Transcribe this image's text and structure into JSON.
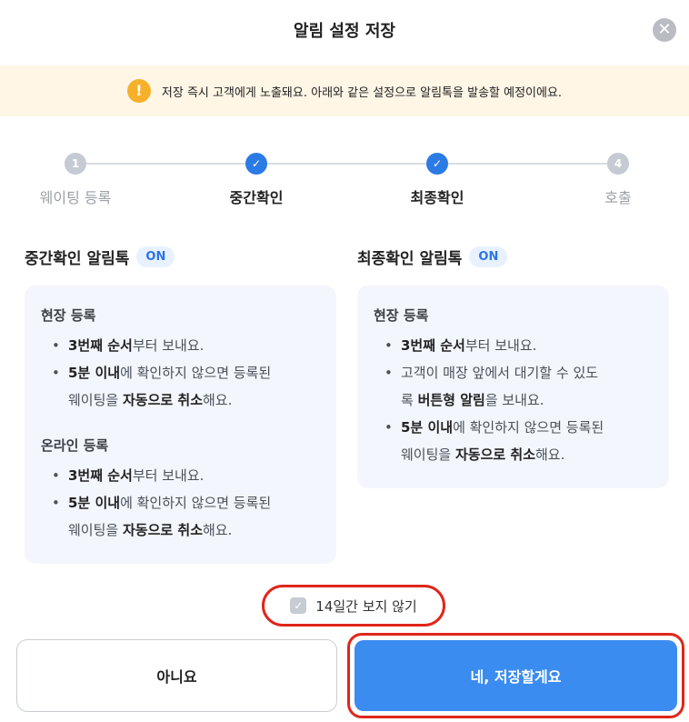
{
  "dialog": {
    "title": "알림 설정 저장",
    "close_icon": "close-icon"
  },
  "notice": {
    "icon": "exclamation-icon",
    "text": "저장 즉시 고객에게 노출돼요. 아래와 같은 설정으로  알림톡을 발송할 예정이에요."
  },
  "steps": [
    {
      "num": "1",
      "label": "웨이팅 등록",
      "state": "todo"
    },
    {
      "num": "✓",
      "label": "중간확인",
      "state": "done"
    },
    {
      "num": "✓",
      "label": "최종확인",
      "state": "done"
    },
    {
      "num": "4",
      "label": "호출",
      "state": "todo"
    }
  ],
  "middle": {
    "title": "중간확인 알림톡",
    "badge": "ON",
    "onsite": {
      "title": "현장 등록",
      "b1_bold": "3번째 순서",
      "b1_rest": "부터 보내요.",
      "b2_bold": "5분 이내",
      "b2_rest": "에 확인하지 않으면 등록된",
      "b2_line2_pre": "웨이팅을 ",
      "b2_line2_bold": "자동으로 취소",
      "b2_line2_rest": "해요."
    },
    "online": {
      "title": "온라인 등록",
      "b1_bold": "3번째 순서",
      "b1_rest": "부터 보내요.",
      "b2_bold": "5분 이내",
      "b2_rest": "에 확인하지 않으면 등록된",
      "b2_line2_pre": "웨이팅을 ",
      "b2_line2_bold": "자동으로 취소",
      "b2_line2_rest": "해요."
    }
  },
  "final": {
    "title": "최종확인 알림톡",
    "badge": "ON",
    "onsite": {
      "title": "현장 등록",
      "b1_bold": "3번째 순서",
      "b1_rest": "부터 보내요.",
      "b2_line1": "고객이 매장 앞에서 대기할 수 있도",
      "b2_line2_pre": "록 ",
      "b2_line2_bold": "버튼형 알림",
      "b2_line2_rest": "을 보내요.",
      "b3_bold": "5분 이내",
      "b3_rest": "에 확인하지 않으면 등록된",
      "b3_line2_pre": "웨이팅을 ",
      "b3_line2_bold": "자동으로 취소",
      "b3_line2_rest": "해요."
    }
  },
  "dont_show": {
    "label": "14일간 보지 않기",
    "checked": true
  },
  "buttons": {
    "no": "아니요",
    "yes": "네, 저장할게요"
  },
  "colors": {
    "accent": "#3b8cf0",
    "step_done": "#2b7be4",
    "highlight_border": "#e0261a",
    "notice_bg": "#fff6e6",
    "card_bg": "#f3f6fc"
  }
}
